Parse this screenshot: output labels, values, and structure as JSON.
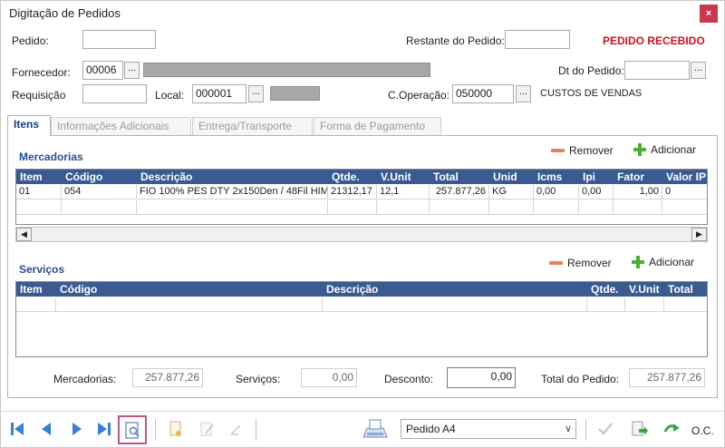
{
  "window": {
    "title": "Digitação de Pedidos",
    "close_label": "×"
  },
  "header": {
    "pedido_label": "Pedido:",
    "pedido_value": "",
    "restante_label": "Restante do Pedido:",
    "restante_value": "",
    "status": "PEDIDO RECEBIDO",
    "status_color": "#cc1122"
  },
  "fornecedor": {
    "label": "Fornecedor:",
    "code": "00006",
    "lookup": "..."
  },
  "dt_pedido": {
    "label": "Dt do Pedido:",
    "value": "",
    "lookup": "..."
  },
  "requisicao": {
    "label": "Requisição",
    "value": ""
  },
  "local": {
    "label": "Local:",
    "code": "000001",
    "lookup": "..."
  },
  "operacao": {
    "label": "C.Operação:",
    "code": "050000",
    "lookup": "...",
    "description": "CUSTOS DE VENDAS"
  },
  "tabs": [
    {
      "label": "Itens",
      "active": true
    },
    {
      "label": "Informações Adicionais",
      "active": false
    },
    {
      "label": "Entrega/Transporte",
      "active": false
    },
    {
      "label": "Forma de Pagamento",
      "active": false
    }
  ],
  "mercadorias": {
    "title": "Mercadorias",
    "remove_label": "Remover",
    "add_label": "Adicionar",
    "columns": [
      "Item",
      "Código",
      "Descrição",
      "Qtde.",
      "V.Unit",
      "Total",
      "Unid",
      "Icms",
      "Ipi",
      "Fator",
      "Valor IP"
    ],
    "rows": [
      [
        "01",
        "054",
        "FIO 100% PES DTY 2x150Den / 48Fil HIM",
        "21312,17",
        "12,1",
        "257.877,26",
        "KG",
        "0,00",
        "0,00",
        "1,00",
        "0"
      ]
    ]
  },
  "scroll": {
    "left": "◀",
    "right": "▶"
  },
  "servicos": {
    "title": "Serviços",
    "remove_label": "Remover",
    "add_label": "Adicionar",
    "columns": [
      "Item",
      "Código",
      "Descrição",
      "Qtde.",
      "V.Unit",
      "Total"
    ]
  },
  "totals": {
    "mercadorias_label": "Mercadorias:",
    "mercadorias_value": "257.877,26",
    "servicos_label": "Serviços:",
    "servicos_value": "0,00",
    "desconto_label": "Desconto:",
    "desconto_value": "0,00",
    "total_label": "Total do Pedido:",
    "total_value": "257.877,26"
  },
  "footer": {
    "report_selected": "Pedido A4",
    "oc_label": "O.C."
  },
  "colors": {
    "accent": "#3b5a92",
    "section_title": "#2a4f8f",
    "nav_blue": "#3a7fd0",
    "add_green": "#4cae32",
    "remove_orange": "#e88060",
    "highlight_border": "#c0587e"
  }
}
